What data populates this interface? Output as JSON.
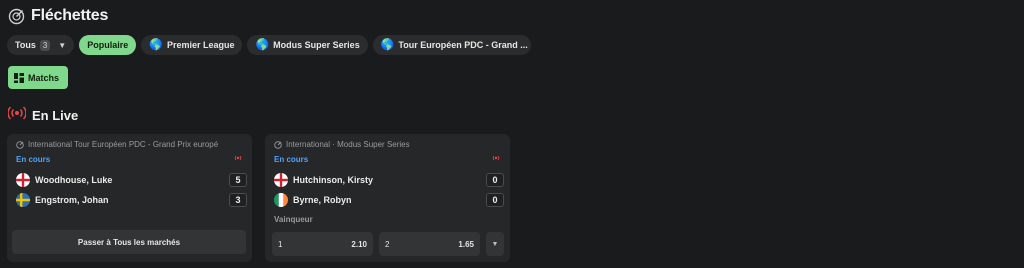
{
  "page": {
    "title": "Fléchettes",
    "title_icon": "dartboard-icon"
  },
  "filters": {
    "all": {
      "label": "Tous",
      "count": "3",
      "icon": "chevron-down-icon"
    },
    "chips": [
      {
        "label": "Populaire",
        "active": true
      },
      {
        "label": "Premier League",
        "icon": "globe-icon"
      },
      {
        "label": "Modus Super Series",
        "icon": "globe-icon"
      },
      {
        "label": "Tour Européen PDC - Grand ...",
        "icon": "globe-icon"
      }
    ]
  },
  "view": {
    "label": "Matchs",
    "icon": "grid-icon"
  },
  "live": {
    "title": "En Live",
    "icon": "broadcast-icon"
  },
  "cards": [
    {
      "competition": "International  Tour Européen PDC - Grand Prix europé",
      "status": "En cours",
      "players": [
        {
          "name": "Woodhouse, Luke",
          "score": "5",
          "flag": "england"
        },
        {
          "name": "Engstrom, Johan",
          "score": "3",
          "flag": "sweden"
        }
      ],
      "button": "Passer à Tous les marchés"
    },
    {
      "competition": "International · Modus Super Series",
      "status": "En cours",
      "players": [
        {
          "name": "Hutchinson, Kirsty",
          "score": "0",
          "flag": "england"
        },
        {
          "name": "Byrne, Robyn",
          "score": "0",
          "flag": "ireland"
        }
      ],
      "market": "Vainqueur",
      "odds": [
        {
          "label": "1",
          "value": "2.10"
        },
        {
          "label": "2",
          "value": "1.65"
        }
      ]
    }
  ],
  "colors": {
    "accent": "#7fd88b",
    "live": "#e5484d",
    "status": "#4da3ff",
    "background": "#1a1b1c",
    "card": "#262728"
  }
}
